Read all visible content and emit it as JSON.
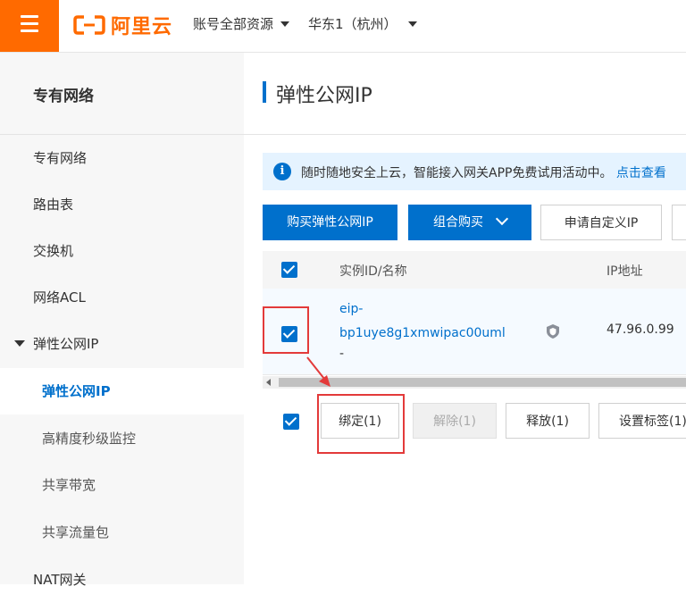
{
  "header": {
    "logo_text": "阿里云",
    "account_dropdown": "账号全部资源",
    "region_dropdown": "华东1（杭州）"
  },
  "sidebar": {
    "title": "专有网络",
    "items": [
      {
        "label": "专有网络"
      },
      {
        "label": "路由表"
      },
      {
        "label": "交换机"
      },
      {
        "label": "网络ACL"
      },
      {
        "label": "弹性公网IP"
      },
      {
        "label": "弹性公网IP"
      },
      {
        "label": "高精度秒级监控"
      },
      {
        "label": "共享带宽"
      },
      {
        "label": "共享流量包"
      },
      {
        "label": "NAT网关"
      }
    ]
  },
  "main": {
    "title": "弹性公网IP",
    "notice": {
      "text": "随时随地安全上云，智能接入网关APP免费试用活动中。",
      "link": "点击查看"
    },
    "toolbar": {
      "buy_label": "购买弹性公网IP",
      "combo_label": "组合购买",
      "custom_label": "申请自定义IP"
    },
    "table": {
      "columns": [
        "实例ID/名称",
        "IP地址"
      ],
      "rows": [
        {
          "id_line1": "eip-",
          "id_line2": "bp1uye8g1xmwipac00uml",
          "name": "-",
          "ip": "47.96.0.99"
        }
      ]
    },
    "batch_actions": {
      "bind": "绑定(1)",
      "unbind": "解除(1)",
      "release": "释放(1)",
      "tags": "设置标签(1)"
    }
  },
  "colors": {
    "brand_orange": "#ff6a00",
    "primary_blue": "#0070cc",
    "annotation_red": "#e33a3a"
  }
}
